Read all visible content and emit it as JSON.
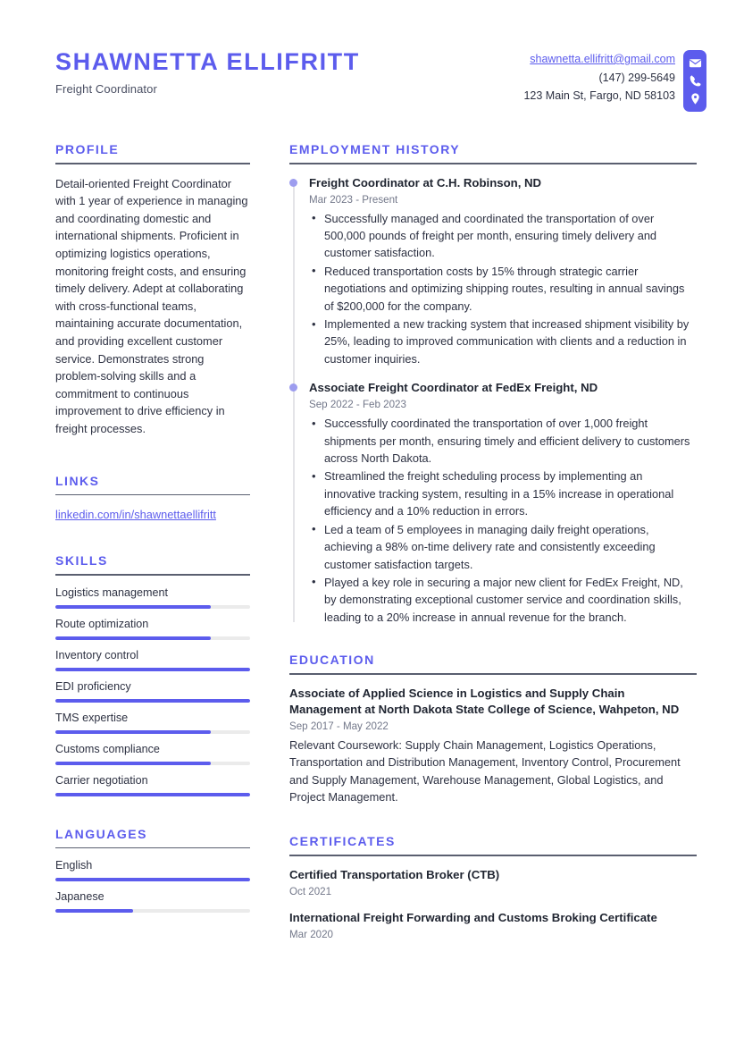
{
  "theme": {
    "accent": "#5c5ced",
    "accent_light": "#9d9def",
    "text": "#2d3142",
    "muted": "#73788a",
    "rule": "#5a5f70",
    "track": "#ebebeb"
  },
  "header": {
    "full_name": "SHAWNETTA ELLIFRITT",
    "job_title": "Freight Coordinator",
    "contact": {
      "email": "shawnetta.ellifritt@gmail.com",
      "phone": "(147) 299-5649",
      "address": "123 Main St, Fargo, ND 58103"
    },
    "icons": [
      "envelope-icon",
      "phone-icon",
      "location-pin-icon"
    ]
  },
  "sections": {
    "profile": {
      "title": "PROFILE",
      "text": "Detail-oriented Freight Coordinator with 1 year of experience in managing and coordinating domestic and international shipments. Proficient in optimizing logistics operations, monitoring freight costs, and ensuring timely delivery. Adept at collaborating with cross-functional teams, maintaining accurate documentation, and providing excellent customer service. Demonstrates strong problem-solving skills and a commitment to continuous improvement to drive efficiency in freight processes."
    },
    "links": {
      "title": "LINKS",
      "items": [
        {
          "label": "linkedin.com/in/shawnettaellifritt"
        }
      ]
    },
    "skills": {
      "title": "SKILLS",
      "items": [
        {
          "label": "Logistics management",
          "level": 80
        },
        {
          "label": "Route optimization",
          "level": 80
        },
        {
          "label": "Inventory control",
          "level": 100
        },
        {
          "label": "EDI proficiency",
          "level": 100
        },
        {
          "label": "TMS expertise",
          "level": 80
        },
        {
          "label": "Customs compliance",
          "level": 80
        },
        {
          "label": "Carrier negotiation",
          "level": 100
        }
      ]
    },
    "languages": {
      "title": "LANGUAGES",
      "items": [
        {
          "label": "English",
          "level": 100
        },
        {
          "label": "Japanese",
          "level": 40
        }
      ]
    },
    "employment": {
      "title": "EMPLOYMENT HISTORY",
      "jobs": [
        {
          "title": "Freight Coordinator at C.H. Robinson, ND",
          "date": "Mar 2023 - Present",
          "bullets": [
            "Successfully managed and coordinated the transportation of over 500,000 pounds of freight per month, ensuring timely delivery and customer satisfaction.",
            "Reduced transportation costs by 15% through strategic carrier negotiations and optimizing shipping routes, resulting in annual savings of $200,000 for the company.",
            "Implemented a new tracking system that increased shipment visibility by 25%, leading to improved communication with clients and a reduction in customer inquiries."
          ]
        },
        {
          "title": "Associate Freight Coordinator at FedEx Freight, ND",
          "date": "Sep 2022 - Feb 2023",
          "bullets": [
            "Successfully coordinated the transportation of over 1,000 freight shipments per month, ensuring timely and efficient delivery to customers across North Dakota.",
            "Streamlined the freight scheduling process by implementing an innovative tracking system, resulting in a 15% increase in operational efficiency and a 10% reduction in errors.",
            "Led a team of 5 employees in managing daily freight operations, achieving a 98% on-time delivery rate and consistently exceeding customer satisfaction targets.",
            "Played a key role in securing a major new client for FedEx Freight, ND, by demonstrating exceptional customer service and coordination skills, leading to a 20% increase in annual revenue for the branch."
          ]
        }
      ]
    },
    "education": {
      "title": "EDUCATION",
      "entries": [
        {
          "title": "Associate of Applied Science in Logistics and Supply Chain Management at North Dakota State College of Science, Wahpeton, ND",
          "date": "Sep 2017 - May 2022",
          "body": "Relevant Coursework: Supply Chain Management, Logistics Operations, Transportation and Distribution Management, Inventory Control, Procurement and Supply Management, Warehouse Management, Global Logistics, and Project Management."
        }
      ]
    },
    "certificates": {
      "title": "CERTIFICATES",
      "entries": [
        {
          "title": "Certified Transportation Broker (CTB)",
          "date": "Oct 2021"
        },
        {
          "title": "International Freight Forwarding and Customs Broking Certificate",
          "date": "Mar 2020"
        }
      ]
    }
  }
}
